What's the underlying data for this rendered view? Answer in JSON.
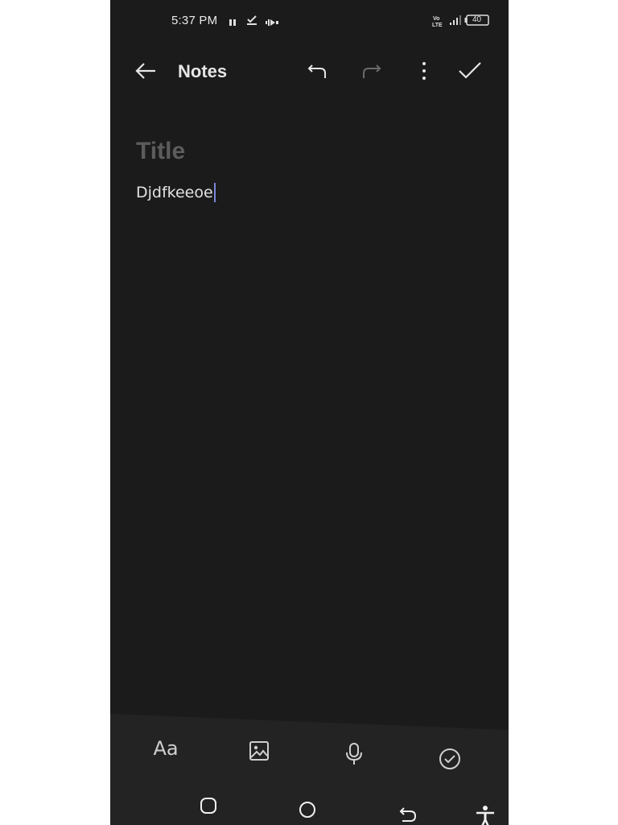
{
  "status_bar": {
    "time": "5:37 PM",
    "battery": "40",
    "network_label": "Vo LTE"
  },
  "app_bar": {
    "title": "Notes",
    "back_icon": "arrow-left-icon",
    "undo_icon": "undo-icon",
    "redo_icon": "redo-icon",
    "more_icon": "more-vertical-icon",
    "done_icon": "check-icon"
  },
  "editor": {
    "title_placeholder": "Title",
    "body_text": "Djdfkeeoe"
  },
  "toolbar": {
    "text_format_label": "Aa",
    "items": [
      "text-format-icon",
      "image-icon",
      "microphone-icon",
      "checklist-icon"
    ]
  },
  "nav_bar": {
    "items": [
      "recents-icon",
      "home-icon",
      "back-icon",
      "accessibility-icon"
    ]
  },
  "colors": {
    "background": "#1b1b1b",
    "toolbar": "#232323",
    "caret": "#7b86d9",
    "title_placeholder": "#5c5c5c",
    "text": "#e2e2e2"
  }
}
